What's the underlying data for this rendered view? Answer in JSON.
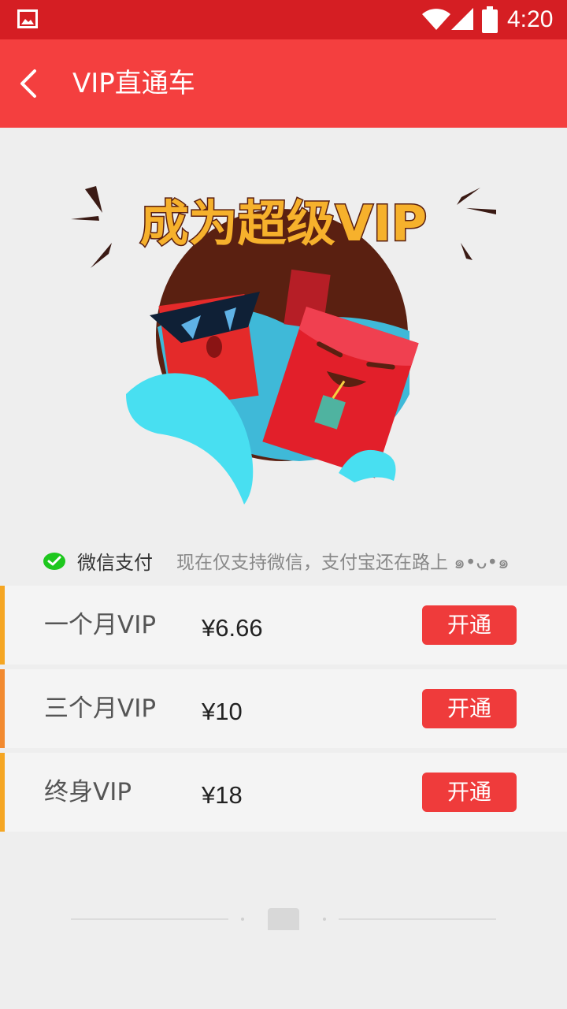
{
  "status_bar": {
    "time": "4:20",
    "icons": [
      "gallery-icon",
      "wifi-icon",
      "signal-icon",
      "battery-icon"
    ]
  },
  "app_bar": {
    "title": "VIP直通车",
    "back_icon": "chevron-left-icon"
  },
  "banner": {
    "headline": "成为超级VIP"
  },
  "payment": {
    "method_label": "微信支付",
    "note": "现在仅支持微信，支付宝还在路上 ๑•ᴗ•๑",
    "icon": "wechat-pay-icon"
  },
  "plans": [
    {
      "name": "一个月VIP",
      "price": "¥6.66",
      "button": "开通",
      "accent": "#f5a623"
    },
    {
      "name": "三个月VIP",
      "price": "¥10",
      "button": "开通",
      "accent": "#f28a30"
    },
    {
      "name": "终身VIP",
      "price": "¥18",
      "button": "开通",
      "accent": "#f5a623"
    }
  ],
  "colors": {
    "status_bar": "#d51e23",
    "app_bar": "#f43f3f",
    "button": "#ef3b3b",
    "background": "#eeeeee"
  }
}
